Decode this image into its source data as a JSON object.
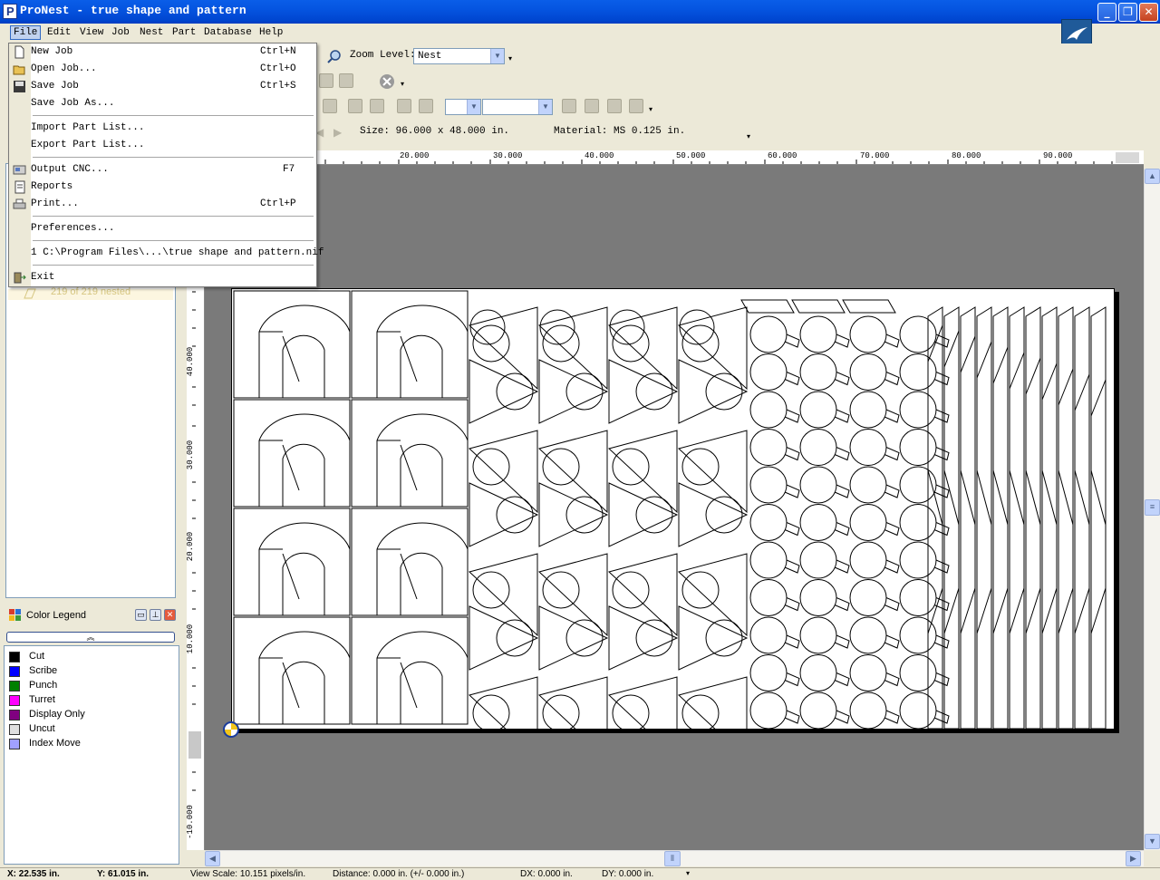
{
  "window": {
    "title": "ProNest - true shape and pattern"
  },
  "menubar": {
    "items": [
      {
        "label": "File",
        "key": "F"
      },
      {
        "label": "Edit",
        "key": "E"
      },
      {
        "label": "View",
        "key": "V"
      },
      {
        "label": "Job",
        "key": "J"
      },
      {
        "label": "Nest",
        "key": "N"
      },
      {
        "label": "Part",
        "key": "P"
      },
      {
        "label": "Database",
        "key": "D"
      },
      {
        "label": "Help",
        "key": "H"
      }
    ]
  },
  "file_menu": {
    "new_job": {
      "label": "New Job",
      "shortcut": "Ctrl+N"
    },
    "open_job": {
      "label": "Open Job...",
      "shortcut": "Ctrl+O"
    },
    "save_job": {
      "label": "Save Job",
      "shortcut": "Ctrl+S"
    },
    "save_job_as": {
      "label": "Save Job As..."
    },
    "import_part_list": {
      "label": "Import Part List..."
    },
    "export_part_list": {
      "label": "Export Part List..."
    },
    "output_cnc": {
      "label": "Output CNC...",
      "shortcut": "F7"
    },
    "reports": {
      "label": "Reports"
    },
    "print": {
      "label": "Print...",
      "shortcut": "Ctrl+P"
    },
    "preferences": {
      "label": "Preferences..."
    },
    "recent_1": {
      "label": "1 C:\\Program Files\\...\\true shape and pattern.nif"
    },
    "exit": {
      "label": "Exit"
    }
  },
  "toolbar": {
    "zoom_level_label": "Zoom Level:",
    "zoom_level_value": "Nest",
    "size_text": "Size: 96.000 x 48.000 in.",
    "material_text": "Material: MS 0.125 in."
  },
  "ruler_top": [
    "20.000",
    "30.000",
    "40.000",
    "50.000",
    "60.000",
    "70.000",
    "80.000",
    "90.000"
  ],
  "ruler_left": [
    "40.000",
    "30.000",
    "20.000",
    "10.000",
    "-10.000"
  ],
  "nest_panel": {
    "summary": "219 of 219 nested"
  },
  "color_legend": {
    "title": "Color Legend",
    "items": [
      {
        "label": "Cut",
        "color": "#000000"
      },
      {
        "label": "Scribe",
        "color": "#0000ff"
      },
      {
        "label": "Punch",
        "color": "#008000"
      },
      {
        "label": "Turret",
        "color": "#ff00ff"
      },
      {
        "label": "Display Only",
        "color": "#800080"
      },
      {
        "label": "Uncut",
        "color": "#e0e0e0"
      },
      {
        "label": "Index Move",
        "color": "#a0a0ff"
      }
    ]
  },
  "statusbar": {
    "x": "X: 22.535 in.",
    "y": "Y: 61.015 in.",
    "view_scale": "View Scale: 10.151 pixels/in.",
    "distance": "Distance: 0.000 in. (+/- 0.000 in.)",
    "dx": "DX: 0.000 in.",
    "dy": "DY: 0.000 in."
  }
}
